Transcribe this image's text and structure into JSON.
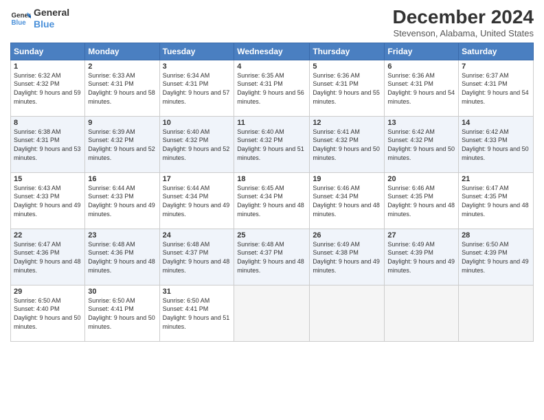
{
  "header": {
    "logo_line1": "General",
    "logo_line2": "Blue",
    "month_title": "December 2024",
    "location": "Stevenson, Alabama, United States"
  },
  "weekdays": [
    "Sunday",
    "Monday",
    "Tuesday",
    "Wednesday",
    "Thursday",
    "Friday",
    "Saturday"
  ],
  "weeks": [
    [
      {
        "day": "1",
        "sunrise": "6:32 AM",
        "sunset": "4:32 PM",
        "daylight": "9 hours and 59 minutes."
      },
      {
        "day": "2",
        "sunrise": "6:33 AM",
        "sunset": "4:31 PM",
        "daylight": "9 hours and 58 minutes."
      },
      {
        "day": "3",
        "sunrise": "6:34 AM",
        "sunset": "4:31 PM",
        "daylight": "9 hours and 57 minutes."
      },
      {
        "day": "4",
        "sunrise": "6:35 AM",
        "sunset": "4:31 PM",
        "daylight": "9 hours and 56 minutes."
      },
      {
        "day": "5",
        "sunrise": "6:36 AM",
        "sunset": "4:31 PM",
        "daylight": "9 hours and 55 minutes."
      },
      {
        "day": "6",
        "sunrise": "6:36 AM",
        "sunset": "4:31 PM",
        "daylight": "9 hours and 54 minutes."
      },
      {
        "day": "7",
        "sunrise": "6:37 AM",
        "sunset": "4:31 PM",
        "daylight": "9 hours and 54 minutes."
      }
    ],
    [
      {
        "day": "8",
        "sunrise": "6:38 AM",
        "sunset": "4:31 PM",
        "daylight": "9 hours and 53 minutes."
      },
      {
        "day": "9",
        "sunrise": "6:39 AM",
        "sunset": "4:32 PM",
        "daylight": "9 hours and 52 minutes."
      },
      {
        "day": "10",
        "sunrise": "6:40 AM",
        "sunset": "4:32 PM",
        "daylight": "9 hours and 52 minutes."
      },
      {
        "day": "11",
        "sunrise": "6:40 AM",
        "sunset": "4:32 PM",
        "daylight": "9 hours and 51 minutes."
      },
      {
        "day": "12",
        "sunrise": "6:41 AM",
        "sunset": "4:32 PM",
        "daylight": "9 hours and 50 minutes."
      },
      {
        "day": "13",
        "sunrise": "6:42 AM",
        "sunset": "4:32 PM",
        "daylight": "9 hours and 50 minutes."
      },
      {
        "day": "14",
        "sunrise": "6:42 AM",
        "sunset": "4:33 PM",
        "daylight": "9 hours and 50 minutes."
      }
    ],
    [
      {
        "day": "15",
        "sunrise": "6:43 AM",
        "sunset": "4:33 PM",
        "daylight": "9 hours and 49 minutes."
      },
      {
        "day": "16",
        "sunrise": "6:44 AM",
        "sunset": "4:33 PM",
        "daylight": "9 hours and 49 minutes."
      },
      {
        "day": "17",
        "sunrise": "6:44 AM",
        "sunset": "4:34 PM",
        "daylight": "9 hours and 49 minutes."
      },
      {
        "day": "18",
        "sunrise": "6:45 AM",
        "sunset": "4:34 PM",
        "daylight": "9 hours and 48 minutes."
      },
      {
        "day": "19",
        "sunrise": "6:46 AM",
        "sunset": "4:34 PM",
        "daylight": "9 hours and 48 minutes."
      },
      {
        "day": "20",
        "sunrise": "6:46 AM",
        "sunset": "4:35 PM",
        "daylight": "9 hours and 48 minutes."
      },
      {
        "day": "21",
        "sunrise": "6:47 AM",
        "sunset": "4:35 PM",
        "daylight": "9 hours and 48 minutes."
      }
    ],
    [
      {
        "day": "22",
        "sunrise": "6:47 AM",
        "sunset": "4:36 PM",
        "daylight": "9 hours and 48 minutes."
      },
      {
        "day": "23",
        "sunrise": "6:48 AM",
        "sunset": "4:36 PM",
        "daylight": "9 hours and 48 minutes."
      },
      {
        "day": "24",
        "sunrise": "6:48 AM",
        "sunset": "4:37 PM",
        "daylight": "9 hours and 48 minutes."
      },
      {
        "day": "25",
        "sunrise": "6:48 AM",
        "sunset": "4:37 PM",
        "daylight": "9 hours and 48 minutes."
      },
      {
        "day": "26",
        "sunrise": "6:49 AM",
        "sunset": "4:38 PM",
        "daylight": "9 hours and 49 minutes."
      },
      {
        "day": "27",
        "sunrise": "6:49 AM",
        "sunset": "4:39 PM",
        "daylight": "9 hours and 49 minutes."
      },
      {
        "day": "28",
        "sunrise": "6:50 AM",
        "sunset": "4:39 PM",
        "daylight": "9 hours and 49 minutes."
      }
    ],
    [
      {
        "day": "29",
        "sunrise": "6:50 AM",
        "sunset": "4:40 PM",
        "daylight": "9 hours and 50 minutes."
      },
      {
        "day": "30",
        "sunrise": "6:50 AM",
        "sunset": "4:41 PM",
        "daylight": "9 hours and 50 minutes."
      },
      {
        "day": "31",
        "sunrise": "6:50 AM",
        "sunset": "4:41 PM",
        "daylight": "9 hours and 51 minutes."
      },
      null,
      null,
      null,
      null
    ]
  ]
}
